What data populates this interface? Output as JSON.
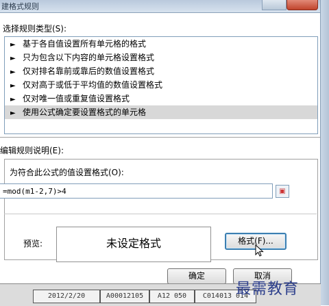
{
  "window": {
    "title": "建格式规则"
  },
  "rule_type": {
    "label": "选择规则类型(S):",
    "items": [
      "基于各自值设置所有单元格的格式",
      "只为包含以下内容的单元格设置格式",
      "仅对排名靠前或靠后的数值设置格式",
      "仅对高于或低于平均值的数值设置格式",
      "仅对唯一值或重复值设置格式",
      "使用公式确定要设置格式的单元格"
    ],
    "selected_index": 5
  },
  "rule_desc": {
    "label": "编辑规则说明(E):",
    "formula_label": "为符合此公式的值设置格式(O):",
    "formula_value": "=mod(m1-2,7)>4"
  },
  "preview": {
    "label": "预览:",
    "text": "未设定格式",
    "format_button": "格式(F)..."
  },
  "buttons": {
    "ok": "确定",
    "cancel": "取消"
  },
  "sheet_row": {
    "c1": "2012/2/20",
    "c2": "A00012105",
    "c3": "A12 050",
    "c4": "C014013 014"
  },
  "watermark": "最需教育"
}
